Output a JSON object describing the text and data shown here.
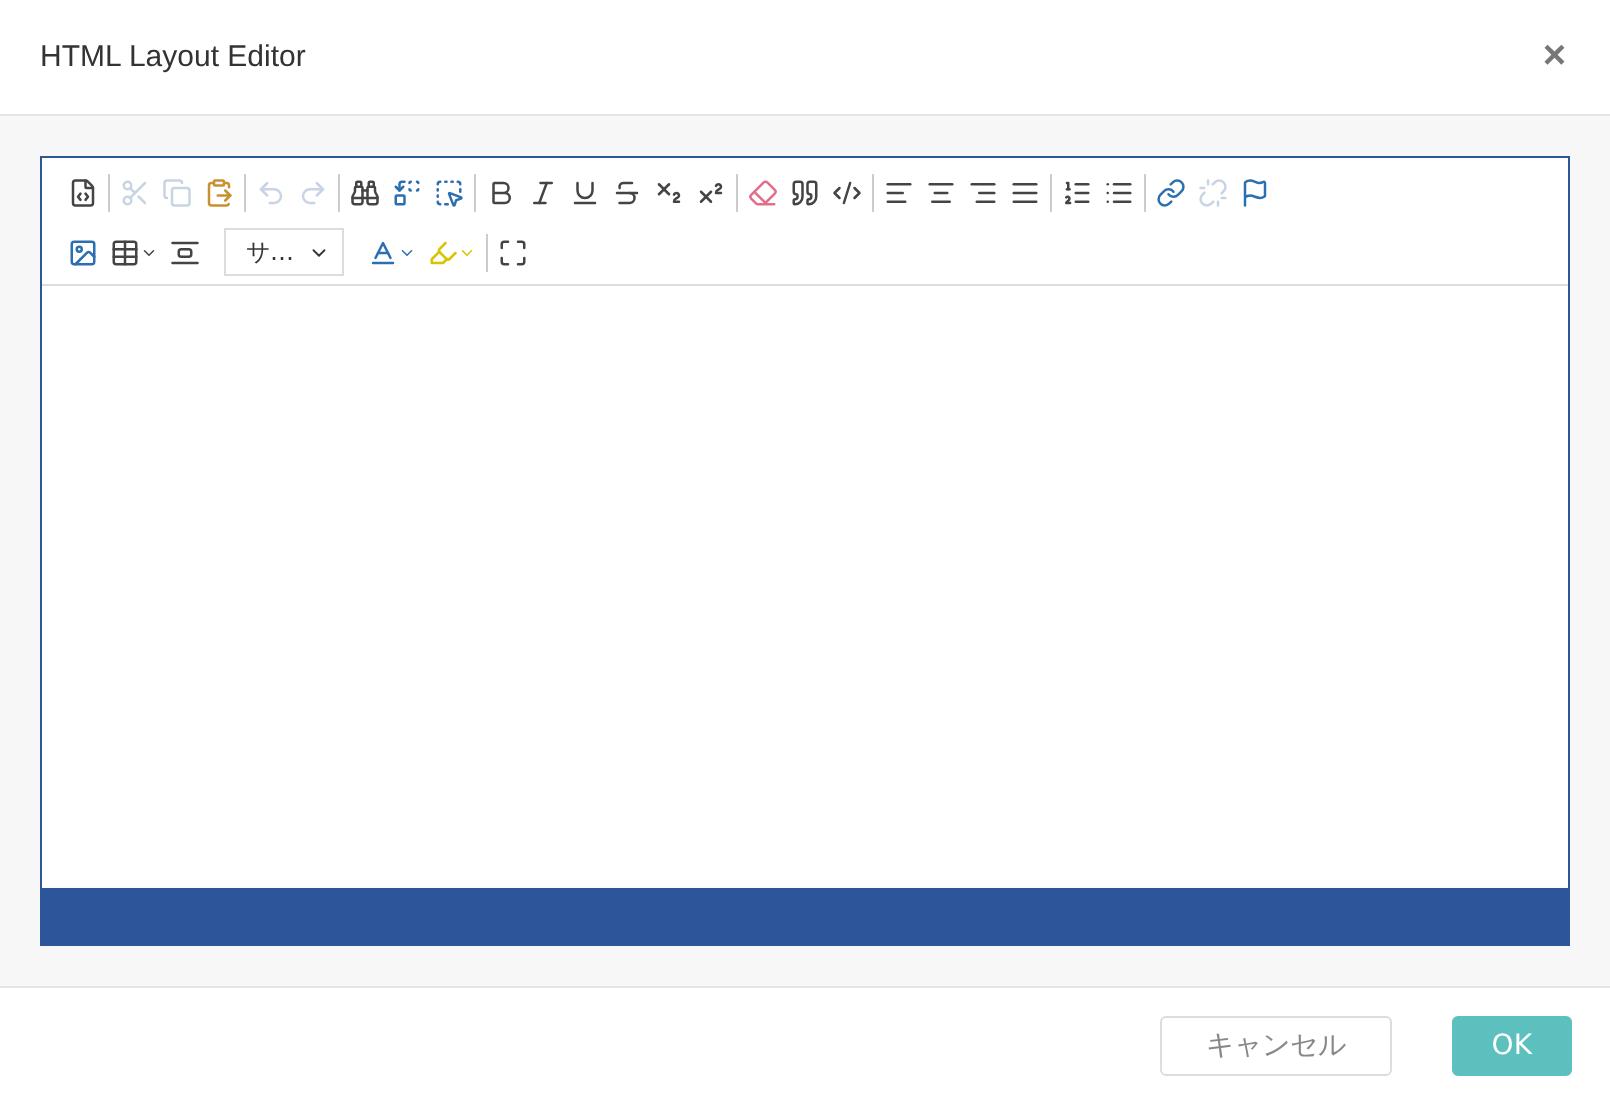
{
  "dialog": {
    "title": "HTML Layout Editor",
    "close": "×"
  },
  "toolbar": {
    "rows": [
      [
        [
          {
            "kind": "source",
            "disabled": false
          }
        ],
        [
          {
            "kind": "cut",
            "disabled": true
          },
          {
            "kind": "copy",
            "disabled": true
          },
          {
            "kind": "paste",
            "disabled": false
          }
        ],
        [
          {
            "kind": "undo",
            "disabled": true
          },
          {
            "kind": "redo",
            "disabled": true
          }
        ],
        [
          {
            "kind": "find",
            "disabled": false
          },
          {
            "kind": "replace",
            "disabled": false
          },
          {
            "kind": "selectall",
            "disabled": false
          }
        ],
        [
          {
            "kind": "bold",
            "disabled": false
          },
          {
            "kind": "italic",
            "disabled": false
          },
          {
            "kind": "underline",
            "disabled": false
          },
          {
            "kind": "strike",
            "disabled": false
          },
          {
            "kind": "subscript",
            "disabled": false
          },
          {
            "kind": "superscript",
            "disabled": false
          }
        ],
        [
          {
            "kind": "removeformat",
            "disabled": false
          },
          {
            "kind": "blockquote",
            "disabled": false
          },
          {
            "kind": "div",
            "disabled": false
          }
        ],
        [
          {
            "kind": "alignleft",
            "disabled": false
          },
          {
            "kind": "aligncenter",
            "disabled": false
          },
          {
            "kind": "alignright",
            "disabled": false
          },
          {
            "kind": "justify",
            "disabled": false
          }
        ],
        [
          {
            "kind": "orderedlist",
            "disabled": false
          },
          {
            "kind": "bulletlist",
            "disabled": false
          }
        ],
        [
          {
            "kind": "link",
            "disabled": false
          },
          {
            "kind": "unlink",
            "disabled": true
          },
          {
            "kind": "anchor",
            "disabled": false
          }
        ]
      ],
      [
        [
          {
            "kind": "image",
            "disabled": false
          },
          {
            "kind": "table",
            "disabled": false
          },
          {
            "kind": "lineheight",
            "disabled": false
          },
          {
            "kind": "select",
            "value": "サ…"
          },
          {
            "kind": "textcolor",
            "disabled": false
          },
          {
            "kind": "bgcolor",
            "disabled": false
          }
        ],
        [
          {
            "kind": "maximize",
            "disabled": false
          }
        ]
      ]
    ]
  },
  "buttons": [
    {
      "label": "キャンセル",
      "kind": "secondary"
    },
    {
      "label": "OK",
      "kind": "primary"
    }
  ]
}
